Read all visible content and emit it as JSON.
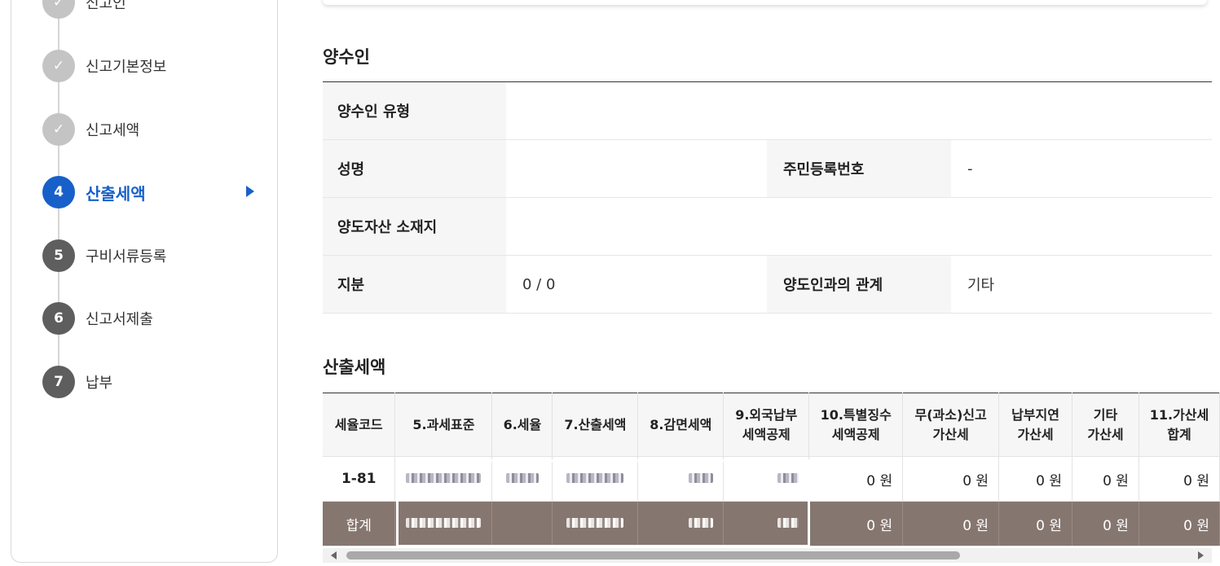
{
  "sidebar": {
    "steps": [
      {
        "num": "✓",
        "label": "신고인",
        "state": "done"
      },
      {
        "num": "✓",
        "label": "신고기본정보",
        "state": "done"
      },
      {
        "num": "✓",
        "label": "신고세액",
        "state": "done"
      },
      {
        "num": "4",
        "label": "산출세액",
        "state": "active"
      },
      {
        "num": "5",
        "label": "구비서류등록",
        "state": "todo"
      },
      {
        "num": "6",
        "label": "신고서제출",
        "state": "todo"
      },
      {
        "num": "7",
        "label": "납부",
        "state": "todo"
      }
    ]
  },
  "transferee": {
    "title": "양수인",
    "type_label": "양수인 유형",
    "type_value": "",
    "name_label": "성명",
    "name_value": "",
    "rrn_label": "주민등록번호",
    "rrn_value": "-",
    "location_label": "양도자산 소재지",
    "location_value": "",
    "share_label": "지분",
    "share_value": "0 / 0",
    "relation_label": "양도인과의 관계",
    "relation_value": "기타"
  },
  "calc": {
    "title": "산출세액",
    "headers": [
      "세율코드",
      "5.과세표준",
      "6.세율",
      "7.산출세액",
      "8.감면세액",
      "9.외국납부\n세액공제",
      "10.특별징수\n세액공제",
      "무(과소)신고\n가산세",
      "납부지연\n가산세",
      "기타\n가산세",
      "11.가산세\n합계"
    ],
    "row": {
      "code": "1-81",
      "v10": "0 원",
      "v11": "0 원",
      "v12": "0 원",
      "v13": "0 원",
      "v14": "0 원"
    },
    "total": {
      "label": "합계",
      "v10": "0 원",
      "v11": "0 원",
      "v12": "0 원",
      "v13": "0 원",
      "v14": "0 원"
    }
  },
  "colors": {
    "accent": "#1760c9",
    "done": "#c4c4c4",
    "todo": "#5e5e5e",
    "total_row": "#867670"
  }
}
